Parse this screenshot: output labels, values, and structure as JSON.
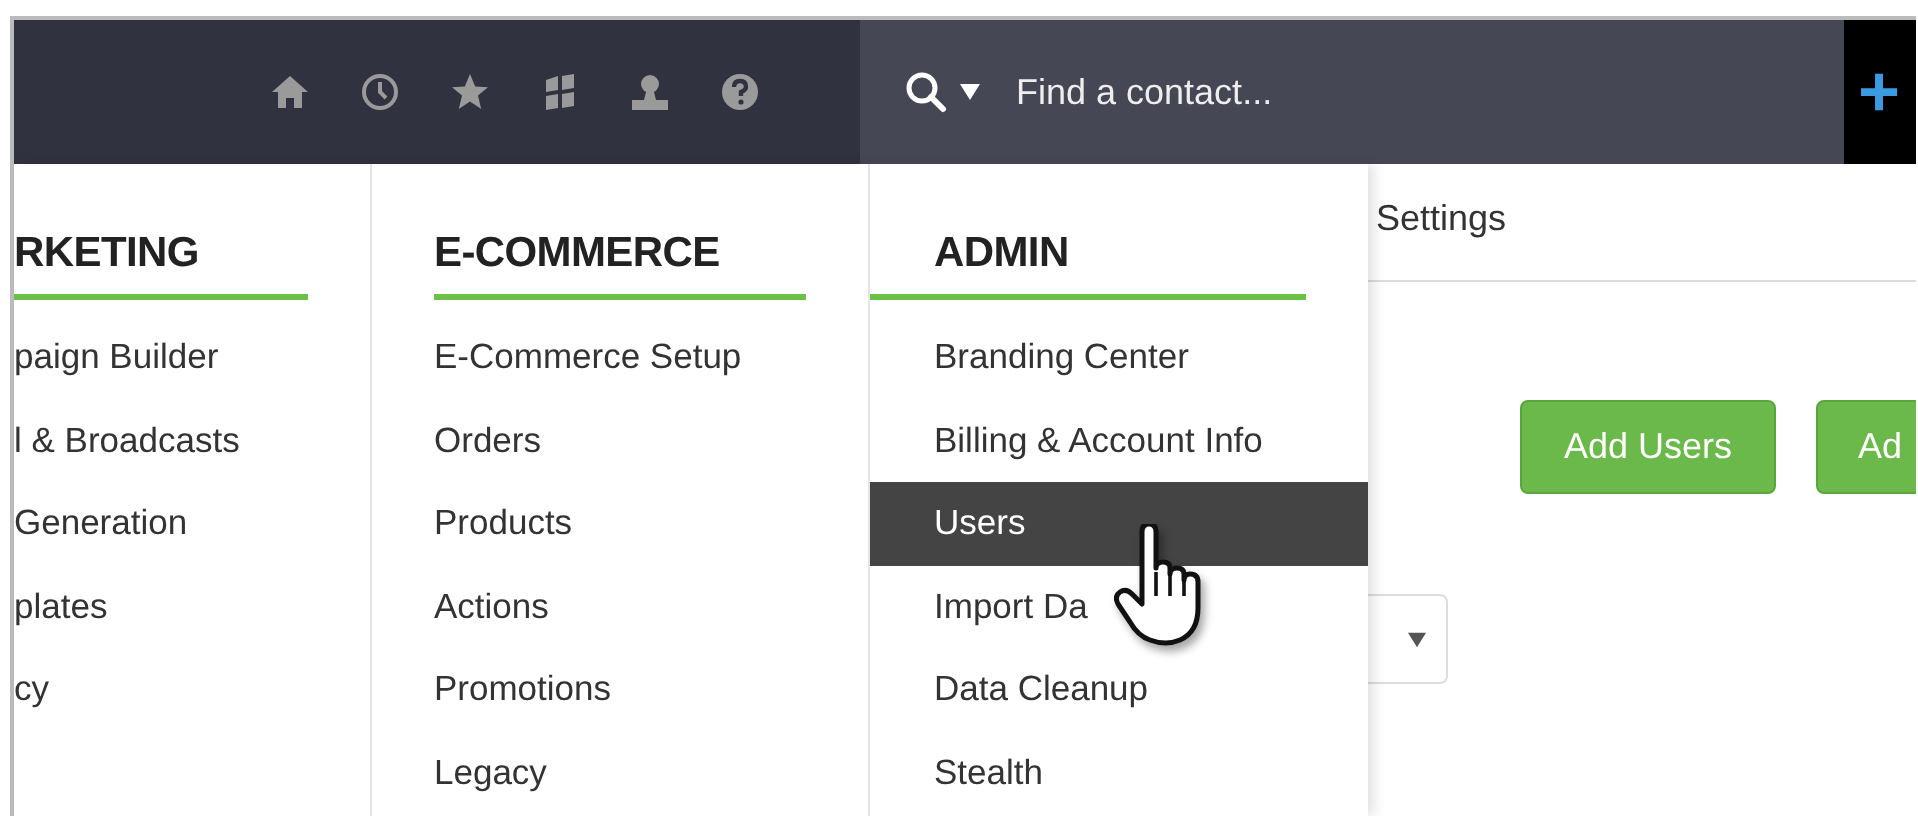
{
  "search": {
    "placeholder": "Find a contact..."
  },
  "add_button": "+",
  "menu": {
    "columns": [
      {
        "heading": "RKETING",
        "items": [
          {
            "label": "paign Builder",
            "selected": false
          },
          {
            "label": "l & Broadcasts",
            "selected": false
          },
          {
            "label": "Generation",
            "selected": false
          },
          {
            "label": "plates",
            "selected": false
          },
          {
            "label": "cy",
            "selected": false
          }
        ]
      },
      {
        "heading": "E-COMMERCE",
        "items": [
          {
            "label": "E-Commerce Setup",
            "selected": false
          },
          {
            "label": "Orders",
            "selected": false
          },
          {
            "label": "Products",
            "selected": false
          },
          {
            "label": "Actions",
            "selected": false
          },
          {
            "label": "Promotions",
            "selected": false
          },
          {
            "label": "Legacy",
            "selected": false
          }
        ]
      },
      {
        "heading": "ADMIN",
        "items": [
          {
            "label": "Branding Center",
            "selected": false
          },
          {
            "label": "Billing & Account Info",
            "selected": false
          },
          {
            "label": "Users",
            "selected": true
          },
          {
            "label": "Import Da",
            "selected": false
          },
          {
            "label": "Data Cleanup",
            "selected": false
          },
          {
            "label": "Stealth",
            "selected": false
          }
        ]
      }
    ]
  },
  "settings_tab": "Settings",
  "buttons": [
    "Add Users",
    "Ad"
  ]
}
